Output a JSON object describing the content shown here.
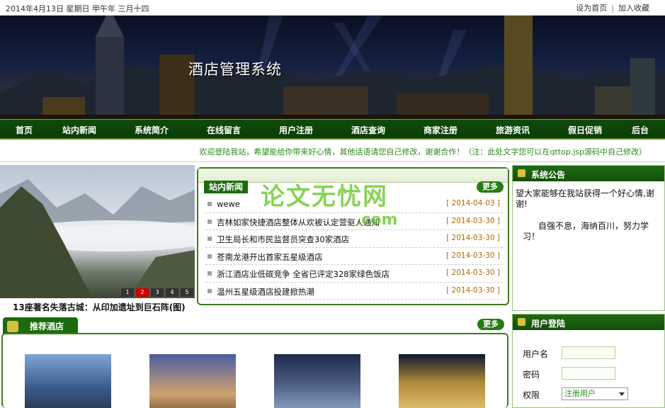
{
  "topbar": {
    "date": "2014年4月13日 星期日 甲午年 三月十四",
    "set_home": "设为首页",
    "separator": "|",
    "add_fav": "加入收藏"
  },
  "banner": {
    "title": "酒店管理系统"
  },
  "nav": {
    "items": [
      "首页",
      "站内新闻",
      "系统简介",
      "在线留言",
      "用户注册",
      "酒店查询",
      "商家注册",
      "旅游资讯",
      "假日促销",
      "后台"
    ]
  },
  "welcome": "欢迎登陆我站，希望能给你带来好心情，其他话语请您自己修改，谢谢合作！（注：此处文字您可以在qttop.jsp源码中自己修改）",
  "photo": {
    "pages": [
      "1",
      "2",
      "3",
      "4",
      "5"
    ],
    "caption": "13座著名失落古城：从印加遗址到巨石阵(图)"
  },
  "news": {
    "tag": "站内新闻",
    "more": "更多",
    "items": [
      {
        "title": "wewe",
        "date": "[ 2014-04-03 ]"
      },
      {
        "title": "吉林如家快捷酒店整体从欢被认定营驱人通知",
        "date": "[ 2014-03-30 ]"
      },
      {
        "title": "卫生局长和市民监督员突查30家酒店",
        "date": "[ 2014-03-30 ]"
      },
      {
        "title": "苍南龙港开出首家五星级酒店",
        "date": "[ 2014-03-30 ]"
      },
      {
        "title": "浙江酒店业低碳竞争 全省已评定328家绿色饭店",
        "date": "[ 2014-03-30 ]"
      },
      {
        "title": "温州五星级酒店投建掀热潮",
        "date": "[ 2014-03-30 ]"
      }
    ]
  },
  "watermark": {
    "line1": "论文无忧网",
    "line2": ".com"
  },
  "recommend": {
    "title": "推荐酒店",
    "more": "更多"
  },
  "notice": {
    "title": "系统公告",
    "lines": [
      "望大家能够在我站获得一个好心情,谢谢!",
      "自强不息，海纳百川，努力学习！"
    ]
  },
  "login": {
    "title": "用户登陆",
    "username_label": "用户名",
    "password_label": "密码",
    "role_label": "权限",
    "role_selected": "注册用户"
  },
  "colors": {
    "nav_green": "#0e4d0a",
    "accent_green": "#2a8a1a",
    "watermark_green": "#62c51d",
    "date_orange": "#b36a00"
  }
}
